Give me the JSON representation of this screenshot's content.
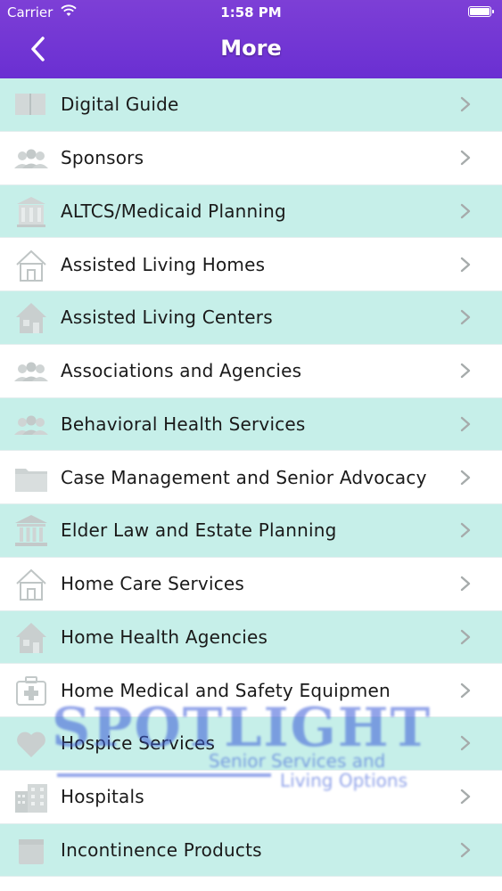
{
  "status_bar": {
    "carrier": "Carrier",
    "time": "1:58 PM"
  },
  "header": {
    "title": "More"
  },
  "items": [
    {
      "label": "Digital Guide",
      "icon": "book-icon"
    },
    {
      "label": "Sponsors",
      "icon": "people-icon"
    },
    {
      "label": "ALTCS/Medicaid Planning",
      "icon": "building-icon"
    },
    {
      "label": "Assisted Living Homes",
      "icon": "house-outline-icon"
    },
    {
      "label": "Assisted Living Centers",
      "icon": "house-icon"
    },
    {
      "label": "Associations and Agencies",
      "icon": "people-icon"
    },
    {
      "label": "Behavioral Health Services",
      "icon": "people-icon"
    },
    {
      "label": "Case Management and Senior Advocacy",
      "icon": "folder-icon"
    },
    {
      "label": "Elder Law and Estate Planning",
      "icon": "courthouse-icon"
    },
    {
      "label": "Home Care Services",
      "icon": "house-outline-icon"
    },
    {
      "label": "Home Health Agencies",
      "icon": "house-icon"
    },
    {
      "label": "Home Medical and Safety Equipmen",
      "icon": "first-aid-icon"
    },
    {
      "label": "Hospice Services",
      "icon": "heart-icon"
    },
    {
      "label": "Hospitals",
      "icon": "hospital-icon"
    },
    {
      "label": "Incontinence Products",
      "icon": "box-icon"
    }
  ],
  "watermark": {
    "title": "SPOTLIGHT",
    "line1": "Senior Services and",
    "line2": "Living Options"
  },
  "colors": {
    "header": "#6a2fd2",
    "row_alt": "#c6efe9",
    "icon": "#c9cfcf"
  }
}
